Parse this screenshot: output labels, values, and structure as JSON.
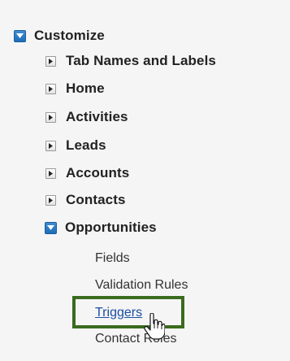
{
  "tree": {
    "root": {
      "label": "Customize",
      "state": "expanded",
      "icon": "expanded-box-icon"
    },
    "items": [
      {
        "label": "Tab Names and Labels",
        "state": "collapsed",
        "icon": "collapsed-arrow-icon"
      },
      {
        "label": "Home",
        "state": "collapsed",
        "icon": "collapsed-arrow-icon"
      },
      {
        "label": "Activities",
        "state": "collapsed",
        "icon": "collapsed-arrow-icon"
      },
      {
        "label": "Leads",
        "state": "collapsed",
        "icon": "collapsed-arrow-icon"
      },
      {
        "label": "Accounts",
        "state": "collapsed",
        "icon": "collapsed-arrow-icon"
      },
      {
        "label": "Contacts",
        "state": "collapsed",
        "icon": "collapsed-arrow-icon"
      },
      {
        "label": "Opportunities",
        "state": "expanded",
        "icon": "expanded-box-icon"
      }
    ],
    "opportunities_children": [
      {
        "label": "Fields"
      },
      {
        "label": "Validation Rules"
      },
      {
        "label": "Triggers",
        "highlighted": true,
        "link": true
      },
      {
        "label": "Contact Roles"
      }
    ]
  },
  "colors": {
    "expanded_icon": "#2a78c4",
    "link": "#1a4fa3",
    "highlight_border": "#3a6b1e"
  },
  "cursor": {
    "icon": "hand-pointer-icon"
  }
}
